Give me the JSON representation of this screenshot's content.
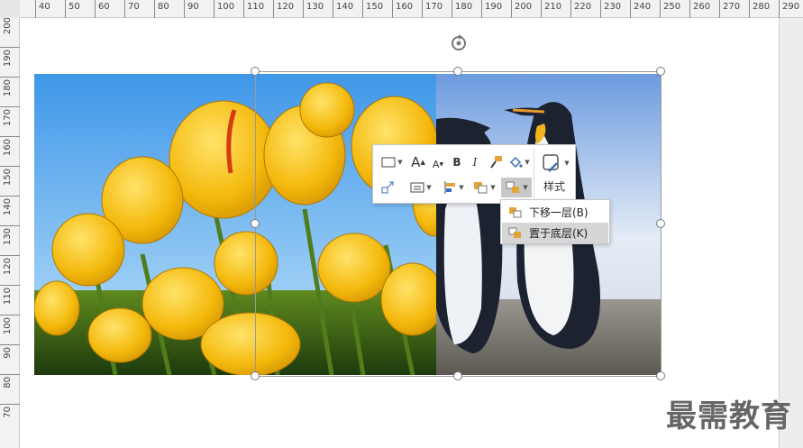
{
  "ruler": {
    "horizontal": [
      "40",
      "50",
      "60",
      "70",
      "80",
      "90",
      "100",
      "110",
      "120",
      "130",
      "140",
      "150",
      "160",
      "170",
      "180",
      "190",
      "200",
      "210",
      "220",
      "230",
      "240",
      "250",
      "260",
      "270",
      "280",
      "290"
    ],
    "vertical": [
      "200",
      "190",
      "180",
      "170",
      "160",
      "150",
      "140",
      "130",
      "120",
      "110",
      "100",
      "90",
      "80",
      "70"
    ]
  },
  "floating_toolbar": {
    "font_grow": "A",
    "font_shrink": "A",
    "bold": "B",
    "italic": "I",
    "style_label": "样式"
  },
  "context_menu": {
    "items": [
      {
        "label": "下移一层(B)"
      },
      {
        "label": "置于底层(K)"
      }
    ]
  },
  "watermark": "最需教育",
  "colors": {
    "accent_icon": "#e3a43a",
    "menu_hover": "#d6d6d6",
    "active_button": "#c8c8c8"
  }
}
